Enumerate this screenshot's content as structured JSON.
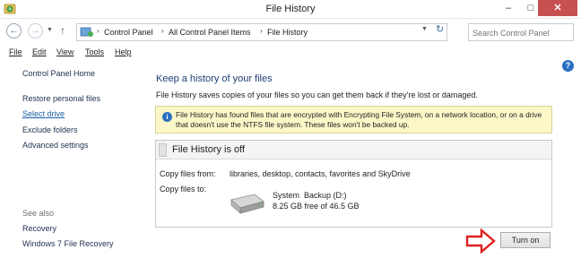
{
  "window": {
    "title": "File History",
    "controls": {
      "minimize": "–",
      "maximize": "□",
      "close": "✕"
    }
  },
  "address": {
    "breadcrumbs": [
      "Control Panel",
      "All Control Panel Items",
      "File History"
    ],
    "search_placeholder": "Search Control Panel"
  },
  "menu": {
    "items": [
      "File",
      "Edit",
      "View",
      "Tools",
      "Help"
    ]
  },
  "sidebar": {
    "home": "Control Panel Home",
    "links": [
      "Restore personal files",
      "Select drive",
      "Exclude folders",
      "Advanced settings"
    ],
    "current": "Select drive",
    "see_also_heading": "See also",
    "see_also": [
      "Recovery",
      "Windows 7 File Recovery"
    ]
  },
  "main": {
    "title": "Keep a history of your files",
    "description": "File History saves copies of your files so you can get them back if they're lost or damaged.",
    "info": "File History has found files that are encrypted with Encrypting File System, on a network location, or on a drive that doesn't use the NTFS file system. These files won't be backed up.",
    "status": {
      "title": "File History is off",
      "copy_from_label": "Copy files from:",
      "copy_from_value": "libraries, desktop, contacts, favorites and SkyDrive",
      "copy_to_label": "Copy files to:",
      "drive_name": "System  Backup (D:)",
      "drive_free": "8.25 GB free of 46.5 GB"
    },
    "turn_on": "Turn on"
  },
  "colors": {
    "title_blue": "#1e3d75",
    "link_blue": "#1a5ea8",
    "info_bg": "#fcf7c8",
    "arrow_red": "#e02020"
  },
  "icons": {
    "app": "file-history-icon",
    "info": "info-icon",
    "help": "help-icon",
    "drive": "hard-drive-icon"
  }
}
